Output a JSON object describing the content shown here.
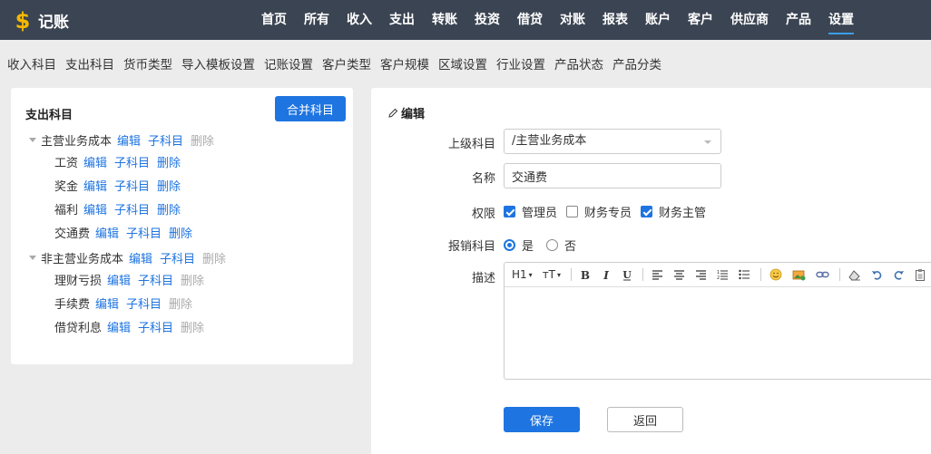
{
  "app": {
    "title": "记账",
    "logo_icon": "dollar-sign-icon",
    "logo_color": "#f5b800"
  },
  "nav": {
    "items": [
      "首页",
      "所有",
      "收入",
      "支出",
      "转账",
      "投资",
      "借贷",
      "对账",
      "报表",
      "账户",
      "客户",
      "供应商",
      "产品",
      "设置"
    ],
    "active": "设置"
  },
  "subnav": {
    "items": [
      "收入科目",
      "支出科目",
      "货币类型",
      "导入模板设置",
      "记账设置",
      "客户类型",
      "客户规模",
      "区域设置",
      "行业设置",
      "产品状态",
      "产品分类"
    ]
  },
  "left": {
    "title": "支出科目",
    "merge_button": "合并科目",
    "actions": {
      "edit": "编辑",
      "child": "子科目",
      "delete": "删除"
    },
    "tree": [
      {
        "name": "主营业务成本",
        "level": 0,
        "expanded": true,
        "delete_enabled": false
      },
      {
        "name": "工资",
        "level": 1,
        "delete_enabled": true
      },
      {
        "name": "奖金",
        "level": 1,
        "delete_enabled": true
      },
      {
        "name": "福利",
        "level": 1,
        "delete_enabled": true
      },
      {
        "name": "交通费",
        "level": 1,
        "delete_enabled": true
      },
      {
        "name": "非主营业务成本",
        "level": 0,
        "expanded": true,
        "delete_enabled": false
      },
      {
        "name": "理财亏损",
        "level": 1,
        "delete_enabled": false
      },
      {
        "name": "手续费",
        "level": 1,
        "delete_enabled": false
      },
      {
        "name": "借贷利息",
        "level": 1,
        "delete_enabled": false
      }
    ]
  },
  "form": {
    "heading": "编辑",
    "parent_label": "上级科目",
    "parent_value": "/主营业务成本",
    "name_label": "名称",
    "name_value": "交通费",
    "perm_label": "权限",
    "permissions": [
      {
        "label": "管理员",
        "checked": true
      },
      {
        "label": "财务专员",
        "checked": false
      },
      {
        "label": "财务主管",
        "checked": true
      }
    ],
    "reimb_label": "报销科目",
    "reimb_options": [
      {
        "label": "是",
        "selected": true
      },
      {
        "label": "否",
        "selected": false
      }
    ],
    "desc_label": "描述",
    "toolbar": {
      "heading": "H1",
      "fontsize": "ᴛT"
    },
    "save": "保存",
    "back": "返回"
  },
  "colors": {
    "topbar": "#3b4452",
    "accent": "#1e74e0",
    "disabled": "#aaaaaa"
  }
}
